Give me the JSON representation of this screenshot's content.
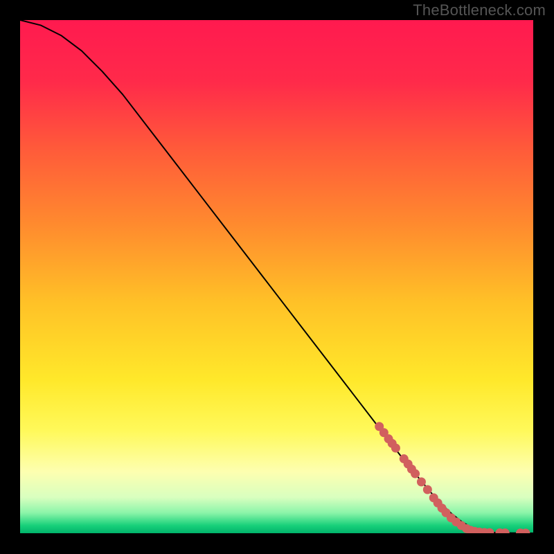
{
  "watermark": "TheBottleneck.com",
  "chart_data": {
    "type": "line",
    "title": "",
    "xlabel": "",
    "ylabel": "",
    "xlim": [
      0,
      100
    ],
    "ylim": [
      0,
      100
    ],
    "axes_visible": false,
    "grid": false,
    "background_gradient": {
      "stops": [
        {
          "offset": 0.0,
          "color": "#ff1a4f"
        },
        {
          "offset": 0.12,
          "color": "#ff2a4a"
        },
        {
          "offset": 0.25,
          "color": "#ff5a3a"
        },
        {
          "offset": 0.4,
          "color": "#ff8b2e"
        },
        {
          "offset": 0.55,
          "color": "#ffc127"
        },
        {
          "offset": 0.7,
          "color": "#ffe82a"
        },
        {
          "offset": 0.8,
          "color": "#fff95a"
        },
        {
          "offset": 0.88,
          "color": "#fdffb0"
        },
        {
          "offset": 0.93,
          "color": "#d9ffbf"
        },
        {
          "offset": 0.96,
          "color": "#8cf5a9"
        },
        {
          "offset": 0.985,
          "color": "#18d07a"
        },
        {
          "offset": 1.0,
          "color": "#00b36b"
        }
      ]
    },
    "series": [
      {
        "name": "bottleneck-curve",
        "color": "#000000",
        "stroke_width": 2,
        "x": [
          0,
          4,
          8,
          12,
          16,
          20,
          25,
          30,
          35,
          40,
          45,
          50,
          55,
          60,
          65,
          70,
          75,
          80,
          82,
          84,
          86,
          88,
          90,
          92,
          94,
          96,
          98,
          100
        ],
        "y": [
          100,
          99,
          97,
          94,
          90,
          85.5,
          79,
          72.5,
          66,
          59.5,
          53,
          46.5,
          40,
          33.5,
          27,
          20.5,
          14,
          8,
          5.8,
          3.9,
          2.3,
          1.1,
          0.4,
          0.15,
          0.08,
          0.04,
          0.02,
          0
        ]
      }
    ],
    "markers": [
      {
        "name": "highlight-dots",
        "color": "#d1605e",
        "radius": 6.5,
        "points": [
          {
            "x": 70.0,
            "y": 20.8
          },
          {
            "x": 70.9,
            "y": 19.6
          },
          {
            "x": 71.8,
            "y": 18.4
          },
          {
            "x": 72.5,
            "y": 17.5
          },
          {
            "x": 73.2,
            "y": 16.6
          },
          {
            "x": 74.8,
            "y": 14.5
          },
          {
            "x": 75.6,
            "y": 13.5
          },
          {
            "x": 76.3,
            "y": 12.5
          },
          {
            "x": 77.0,
            "y": 11.6
          },
          {
            "x": 78.2,
            "y": 10.0
          },
          {
            "x": 79.4,
            "y": 8.5
          },
          {
            "x": 80.6,
            "y": 6.9
          },
          {
            "x": 81.4,
            "y": 5.9
          },
          {
            "x": 82.2,
            "y": 4.9
          },
          {
            "x": 83.0,
            "y": 4.0
          },
          {
            "x": 84.0,
            "y": 3.0
          },
          {
            "x": 85.0,
            "y": 2.2
          },
          {
            "x": 86.0,
            "y": 1.5
          },
          {
            "x": 87.0,
            "y": 0.9
          },
          {
            "x": 87.8,
            "y": 0.55
          },
          {
            "x": 88.6,
            "y": 0.35
          },
          {
            "x": 89.5,
            "y": 0.22
          },
          {
            "x": 90.5,
            "y": 0.14
          },
          {
            "x": 91.5,
            "y": 0.1
          },
          {
            "x": 93.5,
            "y": 0.06
          },
          {
            "x": 94.5,
            "y": 0.05
          },
          {
            "x": 97.5,
            "y": 0.03
          },
          {
            "x": 98.5,
            "y": 0.02
          }
        ]
      }
    ]
  }
}
